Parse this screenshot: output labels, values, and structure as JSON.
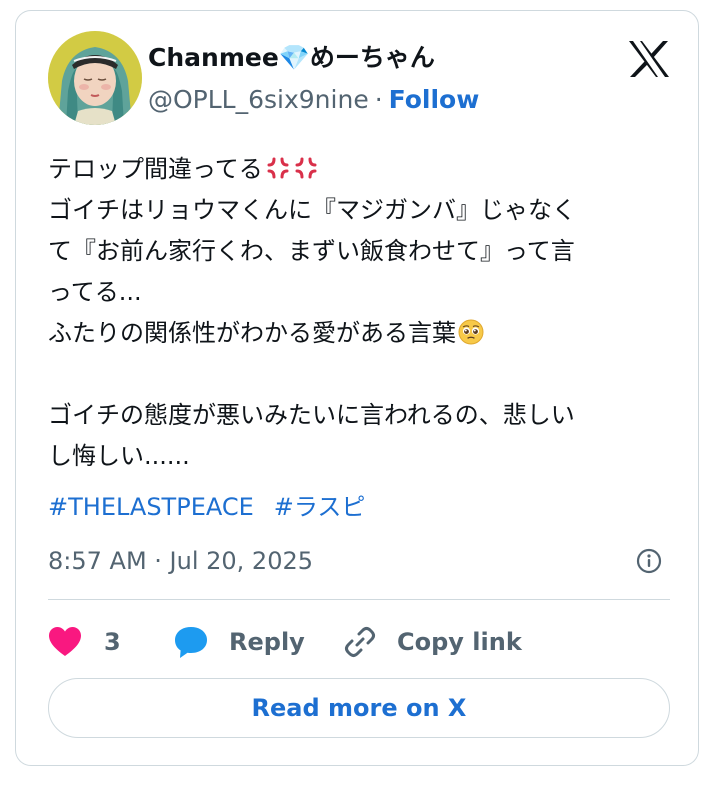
{
  "user": {
    "display_name": "Chanmee💎めーちゃん",
    "handle": "@OPLL_6six9nine",
    "separator": "·",
    "follow_label": "Follow"
  },
  "tweet": {
    "lines": [
      "テロップ間違ってる",
      "ゴイチはリョウマくんに『マジガンバ』じゃなく",
      "て『お前ん家行くわ、まずい飯食わせて』って言",
      "ってる...",
      "ふたりの関係性がわかる愛がある言葉",
      "",
      "ゴイチの態度が悪いみたいに言われるの、悲しい",
      "し悔しい......"
    ],
    "line1_emojis": [
      "anger-symbol",
      "anger-symbol"
    ],
    "line5_emoji": "pleading-face",
    "hashtags": [
      "#THELASTPEACE",
      "#ラスピ"
    ],
    "timestamp": "8:57 AM · Jul 20, 2025"
  },
  "actions": {
    "like_count": "3",
    "reply_label": "Reply",
    "copy_label": "Copy link"
  },
  "read_more_label": "Read more on X",
  "colors": {
    "link": "#1d6fd1",
    "muted": "#536471",
    "like": "#f91880",
    "reply": "#1d9bf0",
    "border": "#cfd9de",
    "anger": "#d9304a"
  },
  "icons": {
    "brand": "x-logo",
    "info": "info-icon",
    "like": "heart-icon",
    "reply": "speech-bubble-icon",
    "copy": "link-icon"
  }
}
